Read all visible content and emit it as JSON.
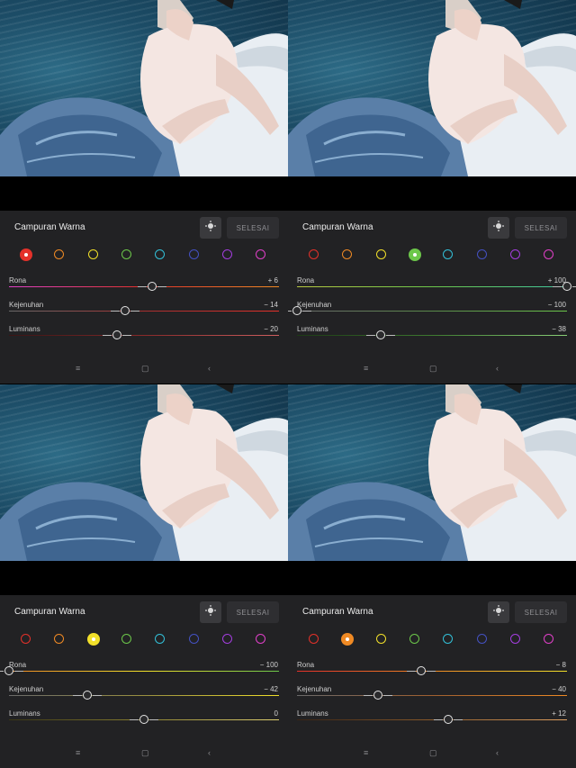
{
  "colors": [
    "#e4312a",
    "#f08a24",
    "#f2e02a",
    "#6cc74a",
    "#33c0d8",
    "#4451c2",
    "#a43ee0",
    "#e040c8"
  ],
  "panels": [
    {
      "title": "Campuran Warna",
      "done_label": "SELESAI",
      "selected_color": 0,
      "sliders": [
        {
          "label": "Rona",
          "value_text": "+ 6",
          "value": 6,
          "gradient": [
            "#e040c8",
            "#e4312a",
            "#f08a24"
          ]
        },
        {
          "label": "Kejenuhan",
          "value_text": "− 14",
          "value": -14,
          "gradient": [
            "#6a6a6a",
            "#a83030",
            "#e4312a"
          ]
        },
        {
          "label": "Luminans",
          "value_text": "− 20",
          "value": -20,
          "gradient": [
            "#3a1414",
            "#8a2a2a",
            "#d06060"
          ]
        }
      ]
    },
    {
      "title": "Campuran Warna",
      "done_label": "SELESAI",
      "selected_color": 3,
      "sliders": [
        {
          "label": "Rona",
          "value_text": "+ 100",
          "value": 100,
          "gradient": [
            "#b8c840",
            "#6cc74a",
            "#40c8a0"
          ]
        },
        {
          "label": "Kejenuhan",
          "value_text": "− 100",
          "value": -100,
          "gradient": [
            "#6a6a6a",
            "#5a8a4a",
            "#6cc74a"
          ]
        },
        {
          "label": "Luminans",
          "value_text": "− 38",
          "value": -38,
          "gradient": [
            "#1c3a14",
            "#3e7a30",
            "#8ad078"
          ]
        }
      ]
    },
    {
      "title": "Campuran Warna",
      "done_label": "SELESAI",
      "selected_color": 2,
      "sliders": [
        {
          "label": "Rona",
          "value_text": "− 100",
          "value": -100,
          "gradient": [
            "#f08a24",
            "#f2e02a",
            "#6cc74a"
          ]
        },
        {
          "label": "Kejenuhan",
          "value_text": "− 42",
          "value": -42,
          "gradient": [
            "#6a6a6a",
            "#9a9040",
            "#f2e02a"
          ]
        },
        {
          "label": "Luminans",
          "value_text": "0",
          "value": 0,
          "gradient": [
            "#3a3614",
            "#8a8030",
            "#e0d070"
          ]
        }
      ]
    },
    {
      "title": "Campuran Warna",
      "done_label": "SELESAI",
      "selected_color": 1,
      "sliders": [
        {
          "label": "Rona",
          "value_text": "− 8",
          "value": -8,
          "gradient": [
            "#e4312a",
            "#f08a24",
            "#f2e02a"
          ]
        },
        {
          "label": "Kejenuhan",
          "value_text": "− 40",
          "value": -40,
          "gradient": [
            "#6a6a6a",
            "#a06030",
            "#f08a24"
          ]
        },
        {
          "label": "Luminans",
          "value_text": "+ 12",
          "value": 12,
          "gradient": [
            "#3a2414",
            "#8a5a2a",
            "#e0a060"
          ]
        }
      ]
    }
  ],
  "nav_icons": [
    "menu-icon",
    "home-square-icon",
    "back-chevron-icon"
  ],
  "nav_glyphs": [
    "≡",
    "▢",
    "‹"
  ]
}
